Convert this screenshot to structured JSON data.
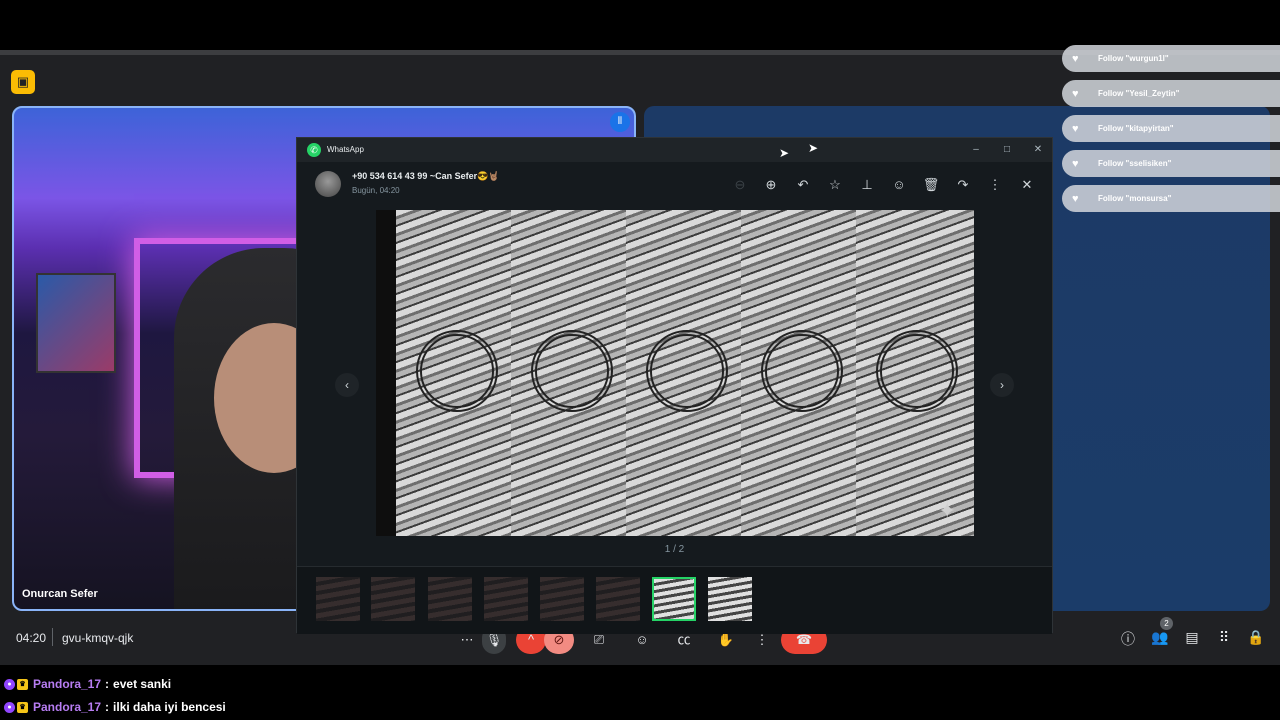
{
  "meet": {
    "participant_name": "Onurcan Sefer",
    "time": "04:20",
    "meeting_code": "gvu-kmqv-qjk",
    "people_count": "2",
    "icons": [
      "mic-icon",
      "camera-off-icon",
      "present-icon",
      "emoji-icon",
      "captions-icon",
      "raise-hand-icon",
      "more-icon",
      "end-call-icon",
      "info-icon",
      "people-icon",
      "chat-icon",
      "apps-icon",
      "lock-icon"
    ],
    "colors": {
      "end_call": "#ea4335",
      "camera_off": "#f28b82",
      "active_border": "#8ab4f8"
    }
  },
  "follows": [
    {
      "text": "Follow \"wurgun1l\""
    },
    {
      "text": "Follow \"Yesil_Zeytin\""
    },
    {
      "text": "Follow \"kitapyirtan\""
    },
    {
      "text": "Follow \"sselisiken\""
    },
    {
      "text": "Follow \"monsursa\""
    }
  ],
  "whatsapp": {
    "title": "WhatsApp",
    "contact": "+90 534 614 43 99 ~Can Sefer😎🤘🏽",
    "date": "Bugün, 04:20",
    "counter": "1 / 2",
    "toolbar_icons": [
      "zoom-in-icon",
      "reply-icon",
      "star-icon",
      "pin-icon",
      "emoji-icon",
      "delete-icon",
      "forward-icon",
      "more-icon",
      "close-icon"
    ],
    "thumbnail_count": 8,
    "active_thumbnail": 7,
    "accent": "#25d366"
  },
  "chat": [
    {
      "user": "Pandora_17",
      "message": "evet sanki"
    },
    {
      "user": "Pandora_17",
      "message": "ilki daha iyi bencesi"
    }
  ]
}
